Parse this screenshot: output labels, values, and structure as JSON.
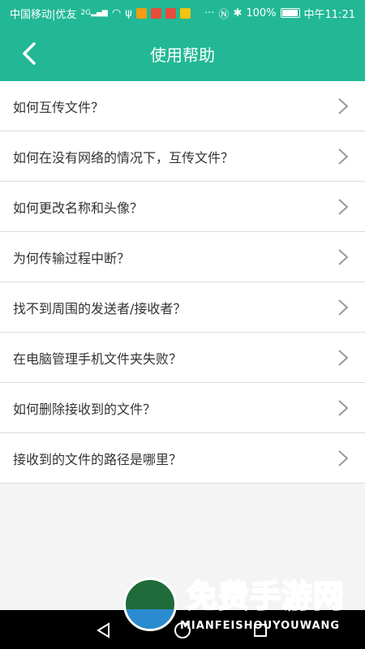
{
  "status_bar": {
    "carrier": "中国移动|优友",
    "signal_label": "2G",
    "battery": "100%",
    "time": "中午11:21"
  },
  "app_bar": {
    "title": "使用帮助"
  },
  "help_items": [
    {
      "label": "如何互传文件？"
    },
    {
      "label": "如何在没有网络的情况下，互传文件？"
    },
    {
      "label": "如何更改名称和头像？"
    },
    {
      "label": "为何传输过程中断？"
    },
    {
      "label": "找不到周围的发送者/接收者？"
    },
    {
      "label": "在电脑管理手机文件夹失败？"
    },
    {
      "label": "如何删除接收到的文件？"
    },
    {
      "label": "接收到的文件的路径是哪里？"
    }
  ],
  "watermark": {
    "brand": "免费手游网",
    "sub": "MIANFEISHOUYOUWANG"
  },
  "colors": {
    "primary": "#22b895",
    "divider": "#dcdcdc",
    "text": "#333333"
  }
}
